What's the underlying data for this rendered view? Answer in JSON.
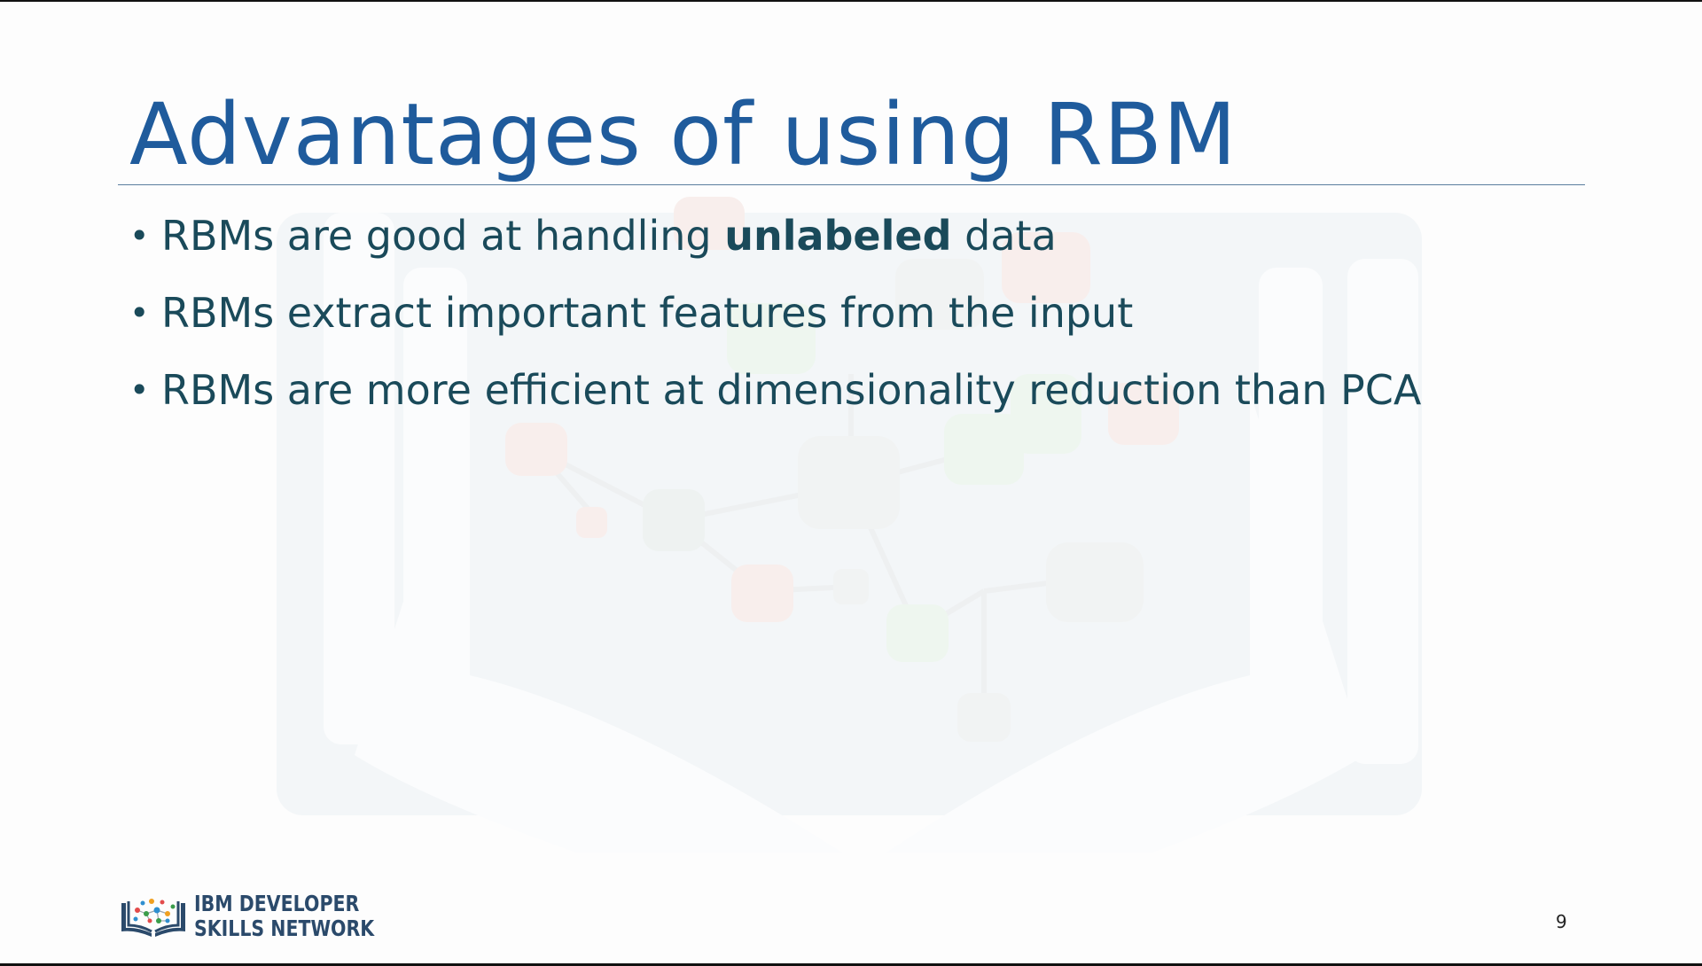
{
  "slide": {
    "title": "Advantages of using RBM",
    "bullets": [
      {
        "before": "RBMs are good at handling ",
        "bold": "unlabeled",
        "after": " data"
      },
      {
        "before": "RBMs extract important features from the input",
        "bold": "",
        "after": ""
      },
      {
        "before": "RBMs are more efficient at dimensionality reduction than PCA",
        "bold": "",
        "after": ""
      }
    ],
    "bullet_symbol": "•",
    "page_number": "9"
  },
  "footer": {
    "logo_line1": "IBM DEVELOPER",
    "logo_line2": "SKILLS NETWORK",
    "logo_icon": "open-book-network-icon"
  },
  "colors": {
    "title": "#1f5b9c",
    "body_text": "#1a4a5a",
    "logo_text": "#2b4a6b",
    "rule": "#5a7e9e"
  }
}
